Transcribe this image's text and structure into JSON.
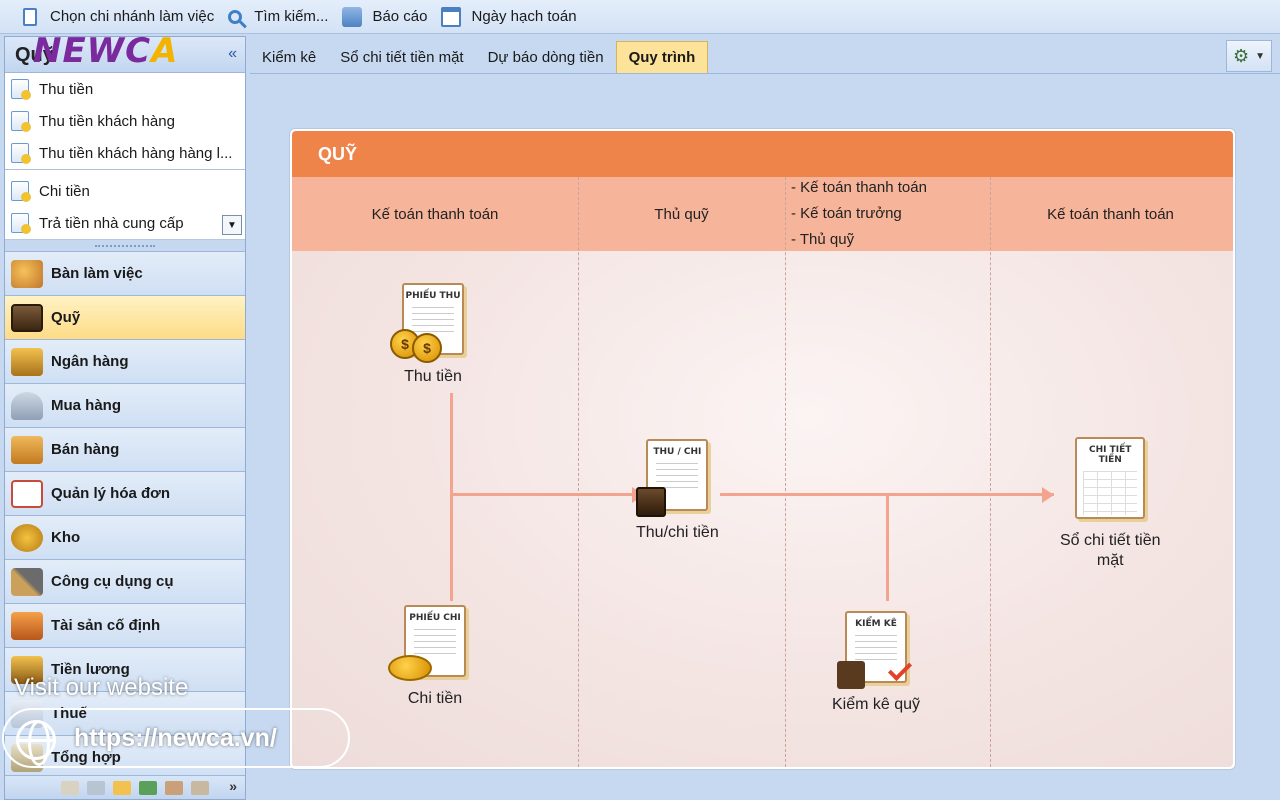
{
  "toolbar": {
    "items": [
      {
        "label": "Chọn chi nhánh làm việc",
        "icon": "branch-doc-icon"
      },
      {
        "label": "Tìm kiếm...",
        "icon": "search-icon"
      },
      {
        "label": "Báo cáo",
        "icon": "report-icon"
      },
      {
        "label": "Ngày hạch toán",
        "icon": "calendar-icon"
      }
    ]
  },
  "logo": {
    "text_left": "NEWC",
    "text_right": "A"
  },
  "sidebar": {
    "title": "Quỹ",
    "collapse_glyph": "«",
    "subitems": [
      {
        "label": "Thu tiền"
      },
      {
        "label": "Thu tiền khách hàng"
      },
      {
        "label": "Thu tiền khách hàng hàng l..."
      },
      {
        "label": "Chi tiền"
      },
      {
        "label": "Trả tiền nhà cung cấp"
      }
    ],
    "nav": [
      {
        "label": "Bàn làm việc",
        "icon": "desk-icon",
        "active": false
      },
      {
        "label": "Quỹ",
        "icon": "safe-icon",
        "active": true
      },
      {
        "label": "Ngân hàng",
        "icon": "bank-icon",
        "active": false
      },
      {
        "label": "Mua hàng",
        "icon": "cart-icon",
        "active": false
      },
      {
        "label": "Bán hàng",
        "icon": "sell-icon",
        "active": false
      },
      {
        "label": "Quản lý hóa đơn",
        "icon": "invoice-icon",
        "active": false
      },
      {
        "label": "Kho",
        "icon": "stock-icon",
        "active": false
      },
      {
        "label": "Công cụ dụng cụ",
        "icon": "tools-icon",
        "active": false
      },
      {
        "label": "Tài sản cố định",
        "icon": "asset-icon",
        "active": false
      },
      {
        "label": "Tiền lương",
        "icon": "salary-icon",
        "active": false
      },
      {
        "label": "Thuế",
        "icon": "tax-icon",
        "active": false
      },
      {
        "label": "Tổng hợp",
        "icon": "summary-icon",
        "active": false
      }
    ],
    "more_glyph": "»"
  },
  "tabs": [
    {
      "label": "Kiểm kê",
      "active": false
    },
    {
      "label": "Sổ chi tiết tiền mặt",
      "active": false
    },
    {
      "label": "Dự báo dòng tiền",
      "active": false
    },
    {
      "label": "Quy trình",
      "active": true
    }
  ],
  "process": {
    "title": "QUỸ",
    "lanes": {
      "lane1": "Kế toán thanh toán",
      "lane2": "Thủ quỹ",
      "lane3": [
        "- Kế toán thanh toán",
        "- Kế toán trưởng",
        "- Thủ quỹ"
      ],
      "lane4": "Kế toán thanh toán"
    },
    "nodes": {
      "receipt": {
        "doc_title": "PHIẾU THU",
        "label": "Thu tiền",
        "coin_glyph": "$"
      },
      "payment": {
        "doc_title": "PHIẾU CHI",
        "label": "Chi tiền"
      },
      "cash": {
        "doc_title": "THU / CHI",
        "label": "Thu/chi tiền"
      },
      "audit": {
        "doc_title": "KIỂM KÊ",
        "label": "Kiểm kê quỹ"
      },
      "ledger": {
        "doc_title": "CHI TIẾT TIỀN",
        "label_line1": "Sổ chi tiết tiền",
        "label_line2": "mặt"
      }
    }
  },
  "promo": {
    "visit": "Visit our website",
    "url": "https://newca.vn/"
  },
  "colors": {
    "accent": "#ee844a",
    "lane_header": "#f6b49a",
    "flow_line": "#f3a48f",
    "active_tab": "#fde39a"
  }
}
